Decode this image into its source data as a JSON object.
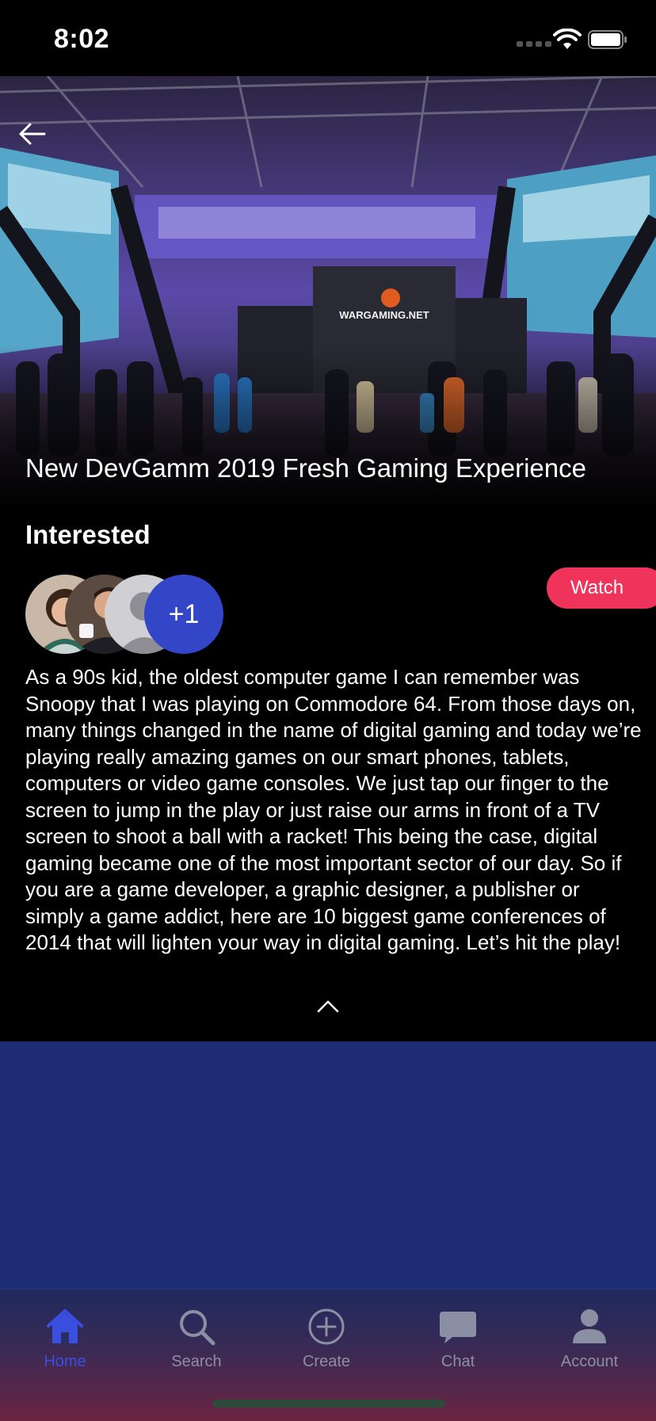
{
  "status_bar": {
    "time": "8:02"
  },
  "event": {
    "title": "New DevGamm 2019 Fresh Gaming Experience"
  },
  "interested": {
    "label": "Interested",
    "extra_count": "+1"
  },
  "watch_button": {
    "label": "Watch"
  },
  "description": "As a 90s kid, the oldest computer game I can remember was Snoopy that I was playing on Commodore 64. From those days on, many things changed in the name of digital gaming and today we’re playing really amazing games on our smart phones, tablets, computers or video game consoles. We just tap our finger to the screen to jump in the play or just raise our arms in front of a TV screen to shoot a ball with a racket! This being the case, digital gaming became one of the most important sector of our day. So if you are a game developer, a graphic designer, a publisher or simply a game addict, here are 10 biggest game conferences of 2014 that will lighten your way in digital gaming. Let’s hit the play!",
  "hero_image": {
    "banner_text": "WARGAMING.NET"
  },
  "tab_bar": {
    "items": [
      {
        "label": "Home",
        "icon": "home-icon",
        "active": true
      },
      {
        "label": "Search",
        "icon": "search-icon",
        "active": false
      },
      {
        "label": "Create",
        "icon": "plus-circle-icon",
        "active": false
      },
      {
        "label": "Chat",
        "icon": "chat-bubble-icon",
        "active": false
      },
      {
        "label": "Account",
        "icon": "person-icon",
        "active": false
      }
    ]
  },
  "colors": {
    "accent_pink": "#f0335a",
    "active_tab": "#3a4ee0",
    "avatar_count_bg": "#3346c8",
    "content_blue": "#1f2e74"
  }
}
